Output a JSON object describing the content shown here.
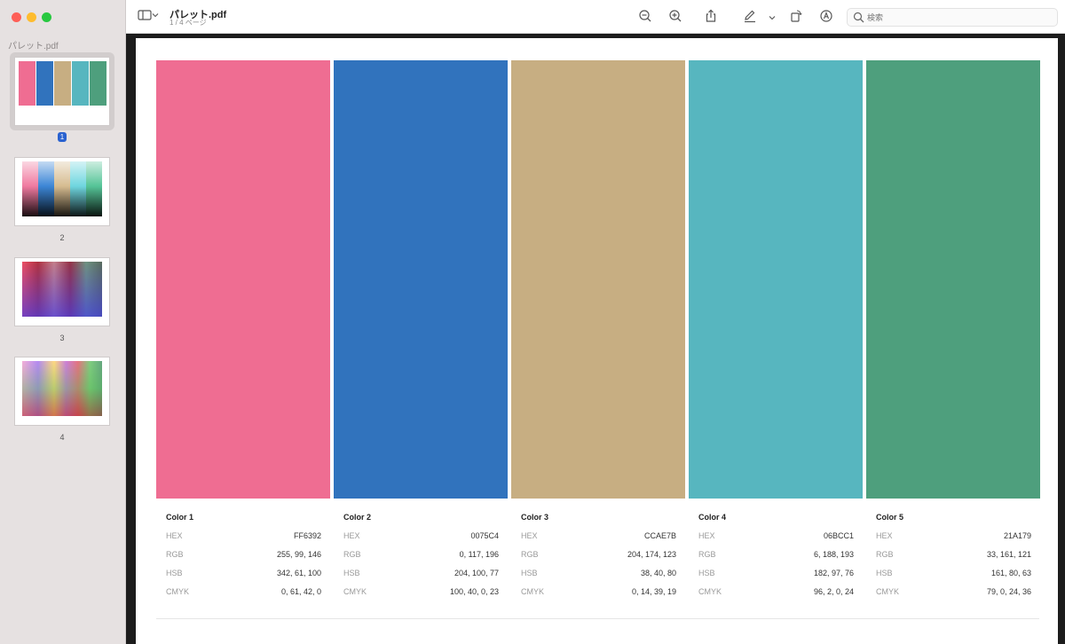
{
  "app": {
    "doc_title": "パレット.pdf",
    "page_info": "1 / 4 ページ"
  },
  "sidebar": {
    "title": "パレット.pdf",
    "thumbnails": [
      {
        "label": "1",
        "selected": true
      },
      {
        "label": "2",
        "selected": false
      },
      {
        "label": "3",
        "selected": false
      },
      {
        "label": "4",
        "selected": false
      }
    ]
  },
  "toolbar": {
    "icons": [
      "sidebar-toggle-icon",
      "chevron-down-icon",
      "zoom-out-icon",
      "zoom-in-icon",
      "share-icon",
      "markup-pen-icon",
      "chevron-down-icon",
      "rotate-icon",
      "annotate-icon",
      "search-icon"
    ],
    "search_placeholder": "検索"
  },
  "palette": {
    "field_labels": {
      "hex": "HEX",
      "rgb": "RGB",
      "hsb": "HSB",
      "cmyk": "CMYK"
    },
    "colors": [
      {
        "name": "Color 1",
        "swatch": "#ef6d92",
        "hex": "FF6392",
        "rgb": "255, 99, 146",
        "hsb": "342, 61, 100",
        "cmyk": "0, 61, 42, 0"
      },
      {
        "name": "Color 2",
        "swatch": "#3173bd",
        "hex": "0075C4",
        "rgb": "0, 117, 196",
        "hsb": "204, 100, 77",
        "cmyk": "100, 40, 0, 23"
      },
      {
        "name": "Color 3",
        "swatch": "#c7ae82",
        "hex": "CCAE7B",
        "rgb": "204, 174, 123",
        "hsb": "38, 40, 80",
        "cmyk": "0, 14, 39, 19"
      },
      {
        "name": "Color 4",
        "swatch": "#57b6bf",
        "hex": "06BCC1",
        "rgb": "6, 188, 193",
        "hsb": "182, 97, 76",
        "cmyk": "96, 2, 0, 24"
      },
      {
        "name": "Color 5",
        "swatch": "#4e9f7d",
        "hex": "21A179",
        "rgb": "33, 161, 121",
        "hsb": "161, 80, 63",
        "cmyk": "79, 0, 24, 36"
      }
    ]
  }
}
